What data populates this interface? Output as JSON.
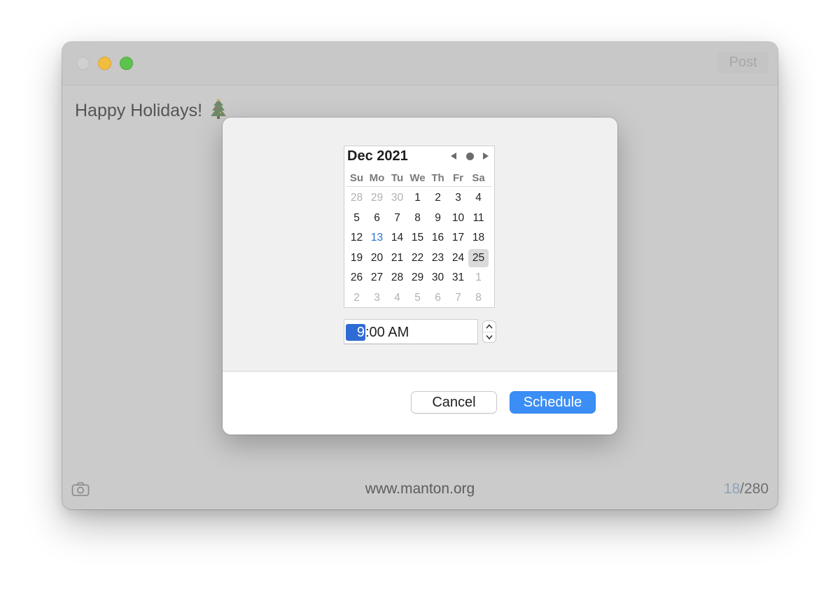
{
  "window": {
    "post_label": "Post"
  },
  "editor": {
    "text": "Happy Holidays!",
    "emoji_icon": "christmas-tree-icon"
  },
  "calendar": {
    "month_label": "Dec 2021",
    "weekdays": [
      "Su",
      "Mo",
      "Tu",
      "We",
      "Th",
      "Fr",
      "Sa"
    ],
    "weeks": [
      [
        {
          "d": "28",
          "o": true
        },
        {
          "d": "29",
          "o": true
        },
        {
          "d": "30",
          "o": true
        },
        {
          "d": "1"
        },
        {
          "d": "2"
        },
        {
          "d": "3"
        },
        {
          "d": "4"
        }
      ],
      [
        {
          "d": "5"
        },
        {
          "d": "6"
        },
        {
          "d": "7"
        },
        {
          "d": "8"
        },
        {
          "d": "9"
        },
        {
          "d": "10"
        },
        {
          "d": "11"
        }
      ],
      [
        {
          "d": "12"
        },
        {
          "d": "13",
          "today": true
        },
        {
          "d": "14"
        },
        {
          "d": "15"
        },
        {
          "d": "16"
        },
        {
          "d": "17"
        },
        {
          "d": "18"
        }
      ],
      [
        {
          "d": "19"
        },
        {
          "d": "20"
        },
        {
          "d": "21"
        },
        {
          "d": "22"
        },
        {
          "d": "23"
        },
        {
          "d": "24"
        },
        {
          "d": "25",
          "sel": true
        }
      ],
      [
        {
          "d": "26"
        },
        {
          "d": "27"
        },
        {
          "d": "28"
        },
        {
          "d": "29"
        },
        {
          "d": "30"
        },
        {
          "d": "31"
        },
        {
          "d": "1",
          "o": true
        }
      ],
      [
        {
          "d": "2",
          "o": true
        },
        {
          "d": "3",
          "o": true
        },
        {
          "d": "4",
          "o": true
        },
        {
          "d": "5",
          "o": true
        },
        {
          "d": "6",
          "o": true
        },
        {
          "d": "7",
          "o": true
        },
        {
          "d": "8",
          "o": true
        }
      ]
    ],
    "today_color": "#2f6fd6"
  },
  "time": {
    "hour": "9",
    "rest": ":00 AM"
  },
  "buttons": {
    "cancel": "Cancel",
    "schedule": "Schedule"
  },
  "footer": {
    "url": "www.manton.org",
    "count": "18",
    "limit": "/280"
  },
  "colors": {
    "accent": "#3b8ef5",
    "selection": "#2f6bd4"
  }
}
